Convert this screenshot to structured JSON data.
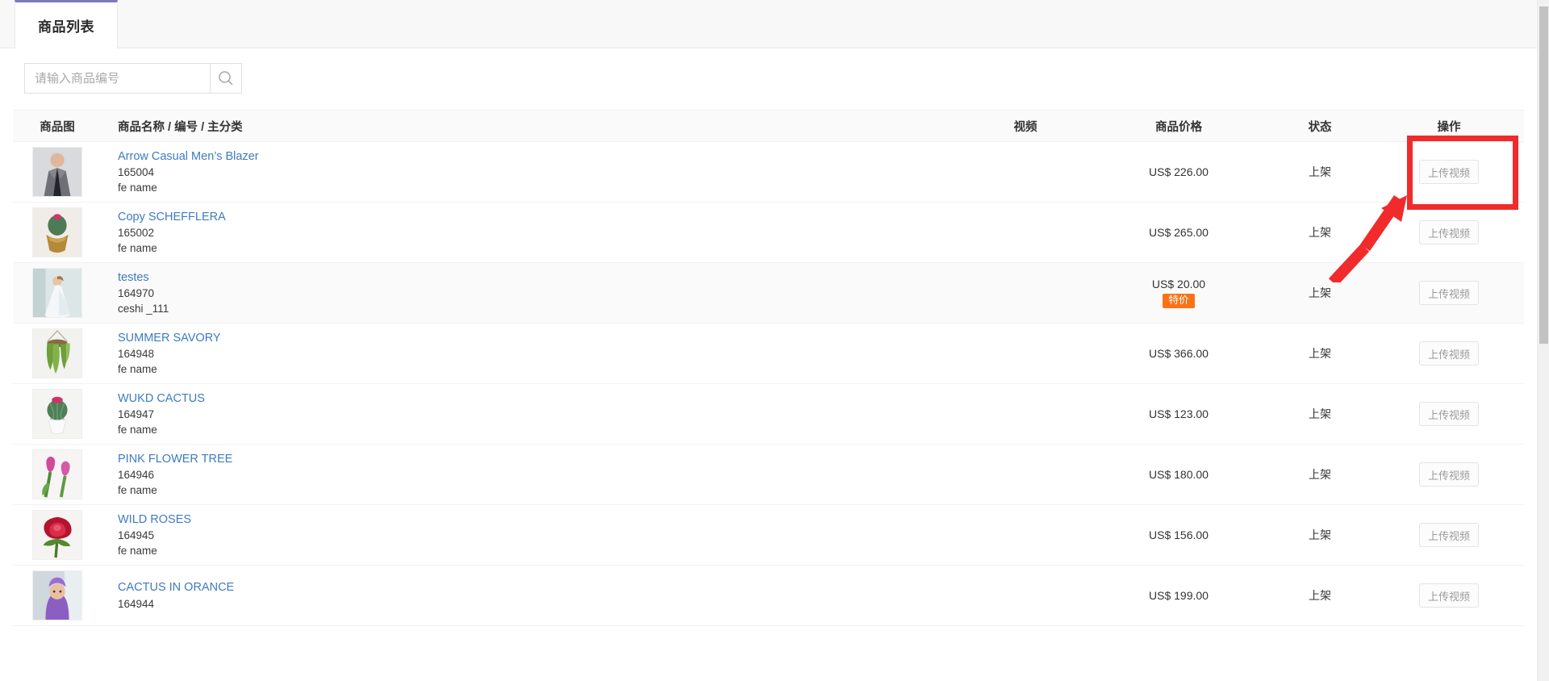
{
  "tabs": [
    {
      "label": "商品列表",
      "active": true
    }
  ],
  "search": {
    "placeholder": "请输入商品编号",
    "value": "",
    "icon": "search-icon"
  },
  "table": {
    "columns": {
      "image": "商品图",
      "name": "商品名称 / 编号 / 主分类",
      "video": "视频",
      "price": "商品价格",
      "state": "状态",
      "action": "操作"
    },
    "rows": [
      {
        "name": "Arrow Casual Men’s Blazer",
        "code": "165004",
        "category": "fe name",
        "video": "",
        "price": "US$ 226.00",
        "badge": "",
        "state": "上架",
        "action": "上传视频",
        "thumb": "man-in-gray-suit-photo",
        "highlighted": false
      },
      {
        "name": "Copy SCHEFFLERA",
        "code": "165002",
        "category": "fe name",
        "video": "",
        "price": "US$ 265.00",
        "badge": "",
        "state": "上架",
        "action": "上传视频",
        "thumb": "cactus-in-gold-pot-photo",
        "highlighted": false
      },
      {
        "name": "testes",
        "code": "164970",
        "category": "ceshi _111",
        "video": "",
        "price": "US$ 20.00",
        "badge": "特价",
        "state": "上架",
        "action": "上传视频",
        "thumb": "bride-in-white-dress-photo",
        "highlighted": true
      },
      {
        "name": "SUMMER SAVORY",
        "code": "164948",
        "category": "fe name",
        "video": "",
        "price": "US$ 366.00",
        "badge": "",
        "state": "上架",
        "action": "上传视频",
        "thumb": "hanging-green-plant-photo",
        "highlighted": false
      },
      {
        "name": "WUKD CACTUS",
        "code": "164947",
        "category": "fe name",
        "video": "",
        "price": "US$ 123.00",
        "badge": "",
        "state": "上架",
        "action": "上传视频",
        "thumb": "pink-flowered-cactus-photo",
        "highlighted": false
      },
      {
        "name": "PINK FLOWER TREE",
        "code": "164946",
        "category": "fe name",
        "video": "",
        "price": "US$ 180.00",
        "badge": "",
        "state": "上架",
        "action": "上传视频",
        "thumb": "two-pink-tulips-photo",
        "highlighted": false
      },
      {
        "name": "WILD ROSES",
        "code": "164945",
        "category": "fe name",
        "video": "",
        "price": "US$ 156.00",
        "badge": "",
        "state": "上架",
        "action": "上传视频",
        "thumb": "red-rose-photo",
        "highlighted": false
      },
      {
        "name": "CACTUS IN ORANCE",
        "code": "164944",
        "category": "",
        "video": "",
        "price": "US$ 199.00",
        "badge": "",
        "state": "上架",
        "action": "上传视频",
        "thumb": "purple-hair-person-photo",
        "highlighted": false
      }
    ]
  },
  "annotations": {
    "highlight_box": {
      "target": "上传视频",
      "color": "#f12b2b"
    },
    "arrow": {
      "color": "#f12b2b",
      "points_to": "上传视频"
    }
  },
  "colors": {
    "tab_accent": "#7b7cb5",
    "link": "#3e7bbf",
    "badge": "#f97316",
    "annotation": "#f12b2b",
    "page_bg": "#f5f5f5"
  }
}
